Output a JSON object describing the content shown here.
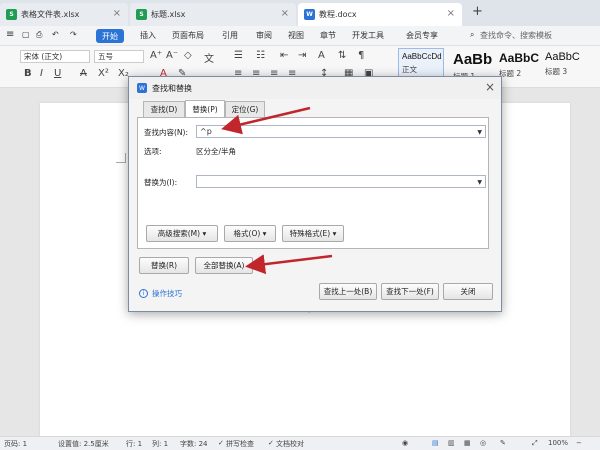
{
  "tabs": [
    {
      "name": "表格文件表.xlsx",
      "icon": "S",
      "color": "#1f9d55"
    },
    {
      "name": "标题.xlsx",
      "icon": "S",
      "color": "#1f9d55"
    },
    {
      "name": "教程.docx",
      "icon": "W",
      "color": "#2b73d6"
    }
  ],
  "new_tab": "+",
  "menu": {
    "start": "开始",
    "items": [
      "插入",
      "页面布局",
      "引用",
      "审阅",
      "视图",
      "章节",
      "开发工具",
      "会员专享"
    ],
    "search": "查找命令、搜索模板"
  },
  "toolbar": {
    "font": "宋体 (正文)",
    "size": "五号",
    "styles": [
      {
        "sample": "AaBbCcDd",
        "name": "正文"
      },
      {
        "sample": "AaBb",
        "name": "标题 1"
      },
      {
        "sample": "AaBbC",
        "name": "标题 2"
      },
      {
        "sample": "AaBbC",
        "name": "标题 3"
      }
    ]
  },
  "dialog": {
    "title": "查找和替换",
    "tabs": [
      "查找(D)",
      "替换(P)",
      "定位(G)"
    ],
    "find_label": "查找内容(N):",
    "find_value": "^p",
    "options_label": "选项:",
    "options_value": "区分全/半角",
    "replace_label": "替换为(I):",
    "replace_value": "",
    "btn_advanced": "高级搜索(M) ▾",
    "btn_format": "格式(O) ▾",
    "btn_special": "特殊格式(E) ▾",
    "btn_replace": "替换(R)",
    "btn_replace_all": "全部替换(A)",
    "tips": "操作技巧",
    "btn_find_prev": "查找上一处(B)",
    "btn_find_next": "查找下一处(F)",
    "btn_close": "关闭"
  },
  "status": {
    "page": "页码: 1",
    "setting": "设置值: 2.5厘米",
    "line": "行: 1",
    "col": "列: 1",
    "words": "字数: 24",
    "spell": "拼写检查",
    "proof": "文档校对",
    "zoom": "100%"
  },
  "colors": {
    "accent": "#2b73d6",
    "arrow": "#c0262c"
  }
}
